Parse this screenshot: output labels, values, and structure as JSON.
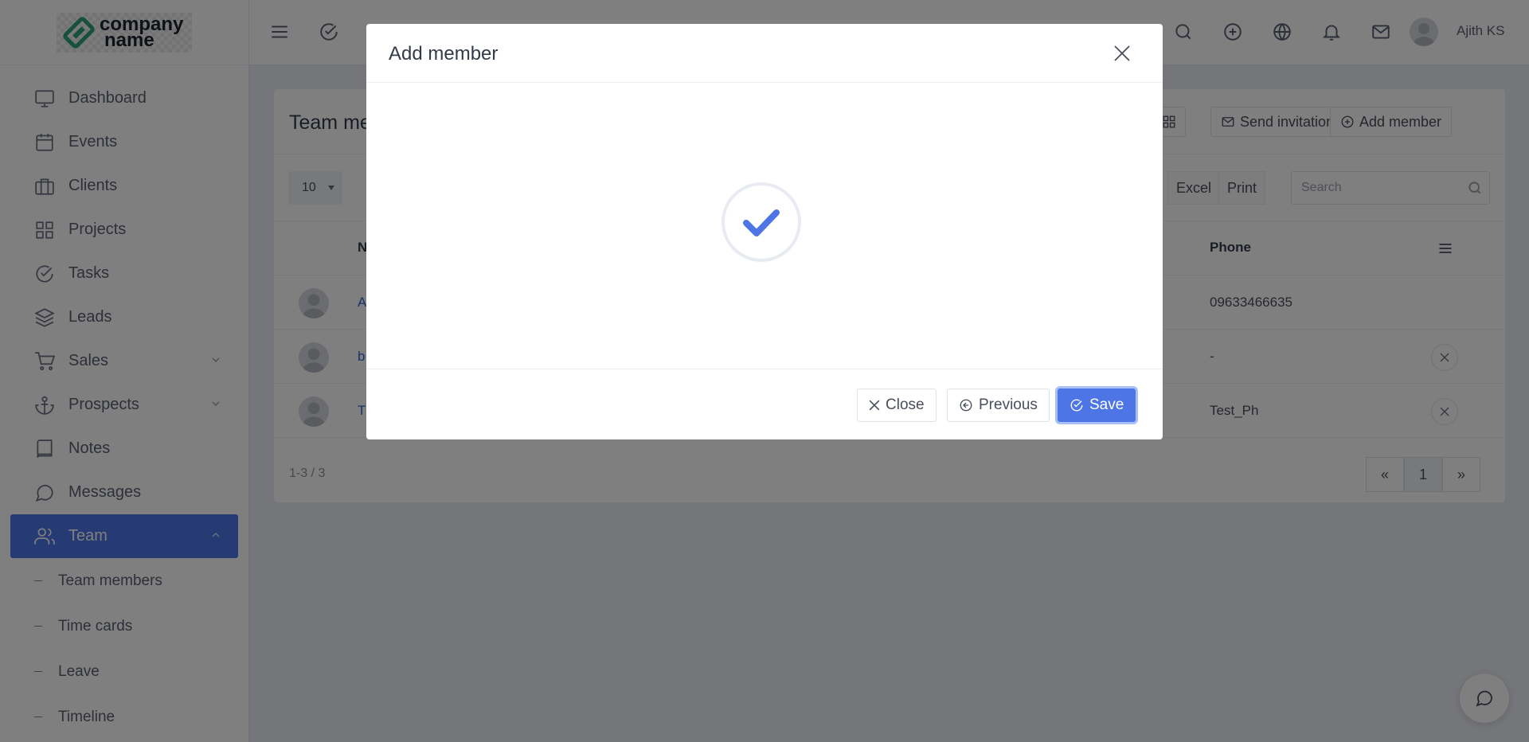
{
  "brand": {
    "logo_line1": "company",
    "logo_line2": "name"
  },
  "sidebar": {
    "items": [
      {
        "label": "Dashboard",
        "icon": "monitor-icon"
      },
      {
        "label": "Events",
        "icon": "calendar-icon"
      },
      {
        "label": "Clients",
        "icon": "briefcase-icon"
      },
      {
        "label": "Projects",
        "icon": "grid-icon"
      },
      {
        "label": "Tasks",
        "icon": "check-circle-icon"
      },
      {
        "label": "Leads",
        "icon": "layers-icon"
      },
      {
        "label": "Sales",
        "icon": "cart-icon"
      },
      {
        "label": "Prospects",
        "icon": "anchor-icon"
      },
      {
        "label": "Notes",
        "icon": "book-icon"
      },
      {
        "label": "Messages",
        "icon": "chat-icon"
      },
      {
        "label": "Team",
        "icon": "users-icon"
      }
    ],
    "sub_items": [
      "Team members",
      "Time cards",
      "Leave",
      "Timeline"
    ]
  },
  "topbar": {
    "user_name": "Ajith KS"
  },
  "card": {
    "title": "Team me",
    "send_invitation_label": "Send invitation",
    "add_member_label": "Add member",
    "page_size": "10",
    "excel_label": "Excel",
    "print_label": "Print",
    "search_placeholder": "Search",
    "columns": {
      "name": "N",
      "phone": "Phone"
    },
    "rows": [
      {
        "name": "A",
        "phone": "09633466635"
      },
      {
        "name": "b",
        "phone": "-"
      },
      {
        "name": "T",
        "phone": "Test_Ph"
      }
    ],
    "count_text": "1-3 / 3",
    "pagination": {
      "prev": "«",
      "current": "1",
      "next": "»"
    }
  },
  "modal": {
    "title": "Add member",
    "close_label": "Close",
    "previous_label": "Previous",
    "save_label": "Save"
  },
  "colors": {
    "accent": "#4d75e6",
    "overlay": "rgba(0,0,0,0.5)"
  }
}
